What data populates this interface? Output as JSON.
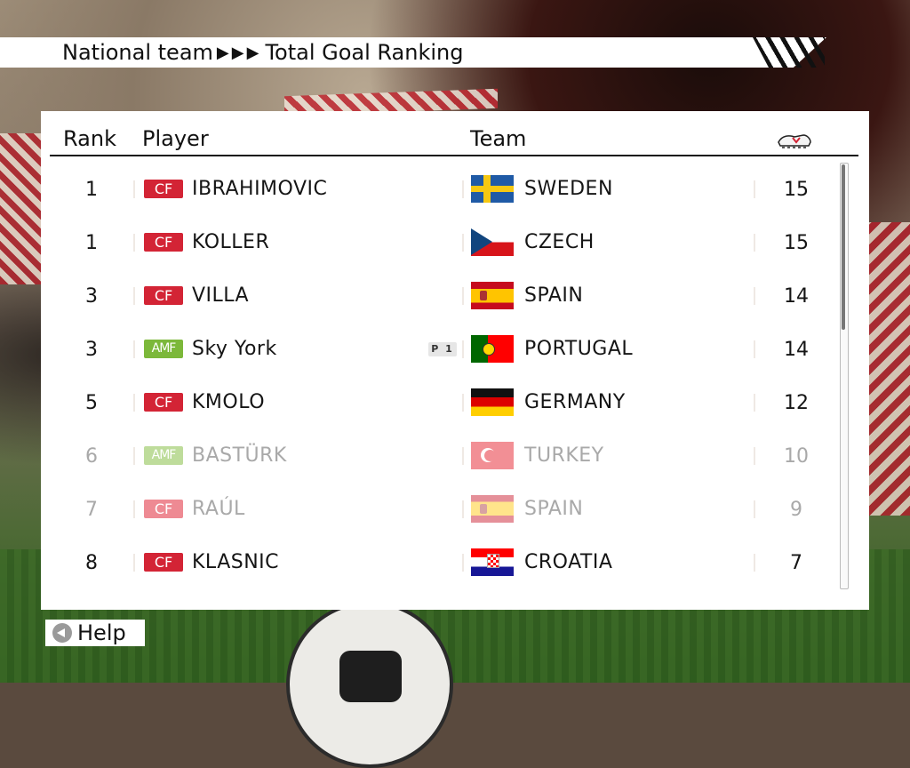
{
  "title_bar": {
    "section": "National team",
    "arrows": "▶▶▶",
    "page": "Total Goal Ranking"
  },
  "table": {
    "headers": {
      "rank": "Rank",
      "player": "Player",
      "team": "Team",
      "goals_icon": "boot-icon"
    },
    "rows": [
      {
        "rank": "1",
        "position": "CF",
        "player": "IBRAHIMOVIC",
        "tag": "",
        "flag": "sweden-flag",
        "team": "SWEDEN",
        "goals": "15",
        "dim": false
      },
      {
        "rank": "1",
        "position": "CF",
        "player": "KOLLER",
        "tag": "",
        "flag": "czech-flag",
        "team": "CZECH",
        "goals": "15",
        "dim": false
      },
      {
        "rank": "3",
        "position": "CF",
        "player": "VILLA",
        "tag": "",
        "flag": "spain-flag",
        "team": "SPAIN",
        "goals": "14",
        "dim": false
      },
      {
        "rank": "3",
        "position": "AMF",
        "player": "Sky York",
        "tag": "P 1",
        "flag": "portugal-flag",
        "team": "PORTUGAL",
        "goals": "14",
        "dim": false
      },
      {
        "rank": "5",
        "position": "CF",
        "player": "KMOLO",
        "tag": "",
        "flag": "germany-flag",
        "team": "GERMANY",
        "goals": "12",
        "dim": false
      },
      {
        "rank": "6",
        "position": "AMF",
        "player": "BASTÜRK",
        "tag": "",
        "flag": "turkey-flag",
        "team": "TURKEY",
        "goals": "10",
        "dim": true
      },
      {
        "rank": "7",
        "position": "CF",
        "player": "RAÚL",
        "tag": "",
        "flag": "spain-flag",
        "team": "SPAIN",
        "goals": "9",
        "dim": true
      },
      {
        "rank": "8",
        "position": "CF",
        "player": "KLASNIC",
        "tag": "",
        "flag": "croatia-flag",
        "team": "CROATIA",
        "goals": "7",
        "dim": false
      }
    ]
  },
  "footer": {
    "help_label": "Help",
    "help_icon": "back-arrow-icon"
  },
  "colors": {
    "cf_badge": "#d32435",
    "amf_badge": "#7cb83a",
    "panel": "#ffffff"
  }
}
